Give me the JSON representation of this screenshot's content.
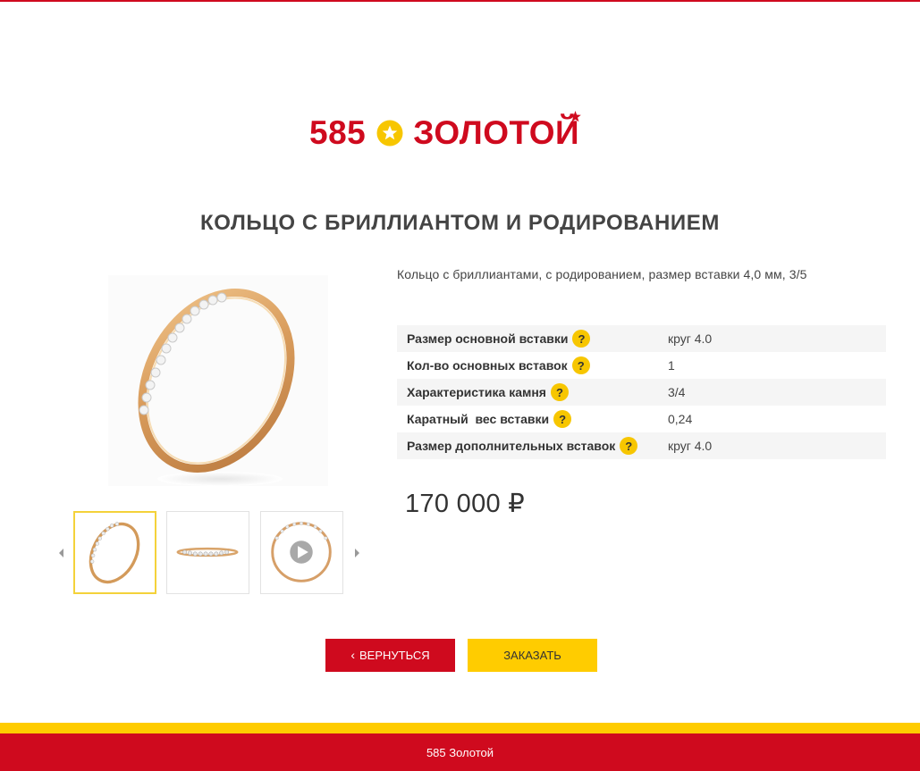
{
  "brand": {
    "number": "585",
    "word": "ЗОЛОТОЙ",
    "color": "#cf0a1e",
    "star_color": "#f7c600"
  },
  "product": {
    "title": "КОЛЬЦО С БРИЛЛИАНТОМ И РОДИРОВАНИЕМ",
    "description": "Кольцо с бриллиантами, с родированием, размер вставки 4,0 мм, 3/5",
    "price": "170 000 ₽"
  },
  "gallery": {
    "main_image": "gold-ring-with-diamonds",
    "thumbnails": [
      {
        "name": "ring-front-view",
        "active": true
      },
      {
        "name": "ring-side-view",
        "active": false
      },
      {
        "name": "ring-video",
        "active": false
      }
    ],
    "prev_icon": "chevron-left-icon",
    "next_icon": "chevron-right-icon"
  },
  "specs": [
    {
      "label": "Размер основной вставки",
      "help": "?",
      "value": "круг 4.0"
    },
    {
      "label": "Кол-во основных вставок",
      "help": "?",
      "value": "1"
    },
    {
      "label": "Характеристика камня",
      "help": "?",
      "value": "3/4"
    },
    {
      "label": "Каратный  вес вставки",
      "help": "?",
      "value": "0,24"
    },
    {
      "label": "Размер дополнительных вставок",
      "help": "?",
      "value": "круг 4.0"
    }
  ],
  "actions": {
    "back_label": "ВЕРНУТЬСЯ",
    "order_label": "ЗАКАЗАТЬ"
  },
  "footer": {
    "text": "585 Золотой"
  },
  "colors": {
    "red": "#cf0a1e",
    "yellow": "#ffcc00",
    "help_yellow": "#f7c600"
  }
}
